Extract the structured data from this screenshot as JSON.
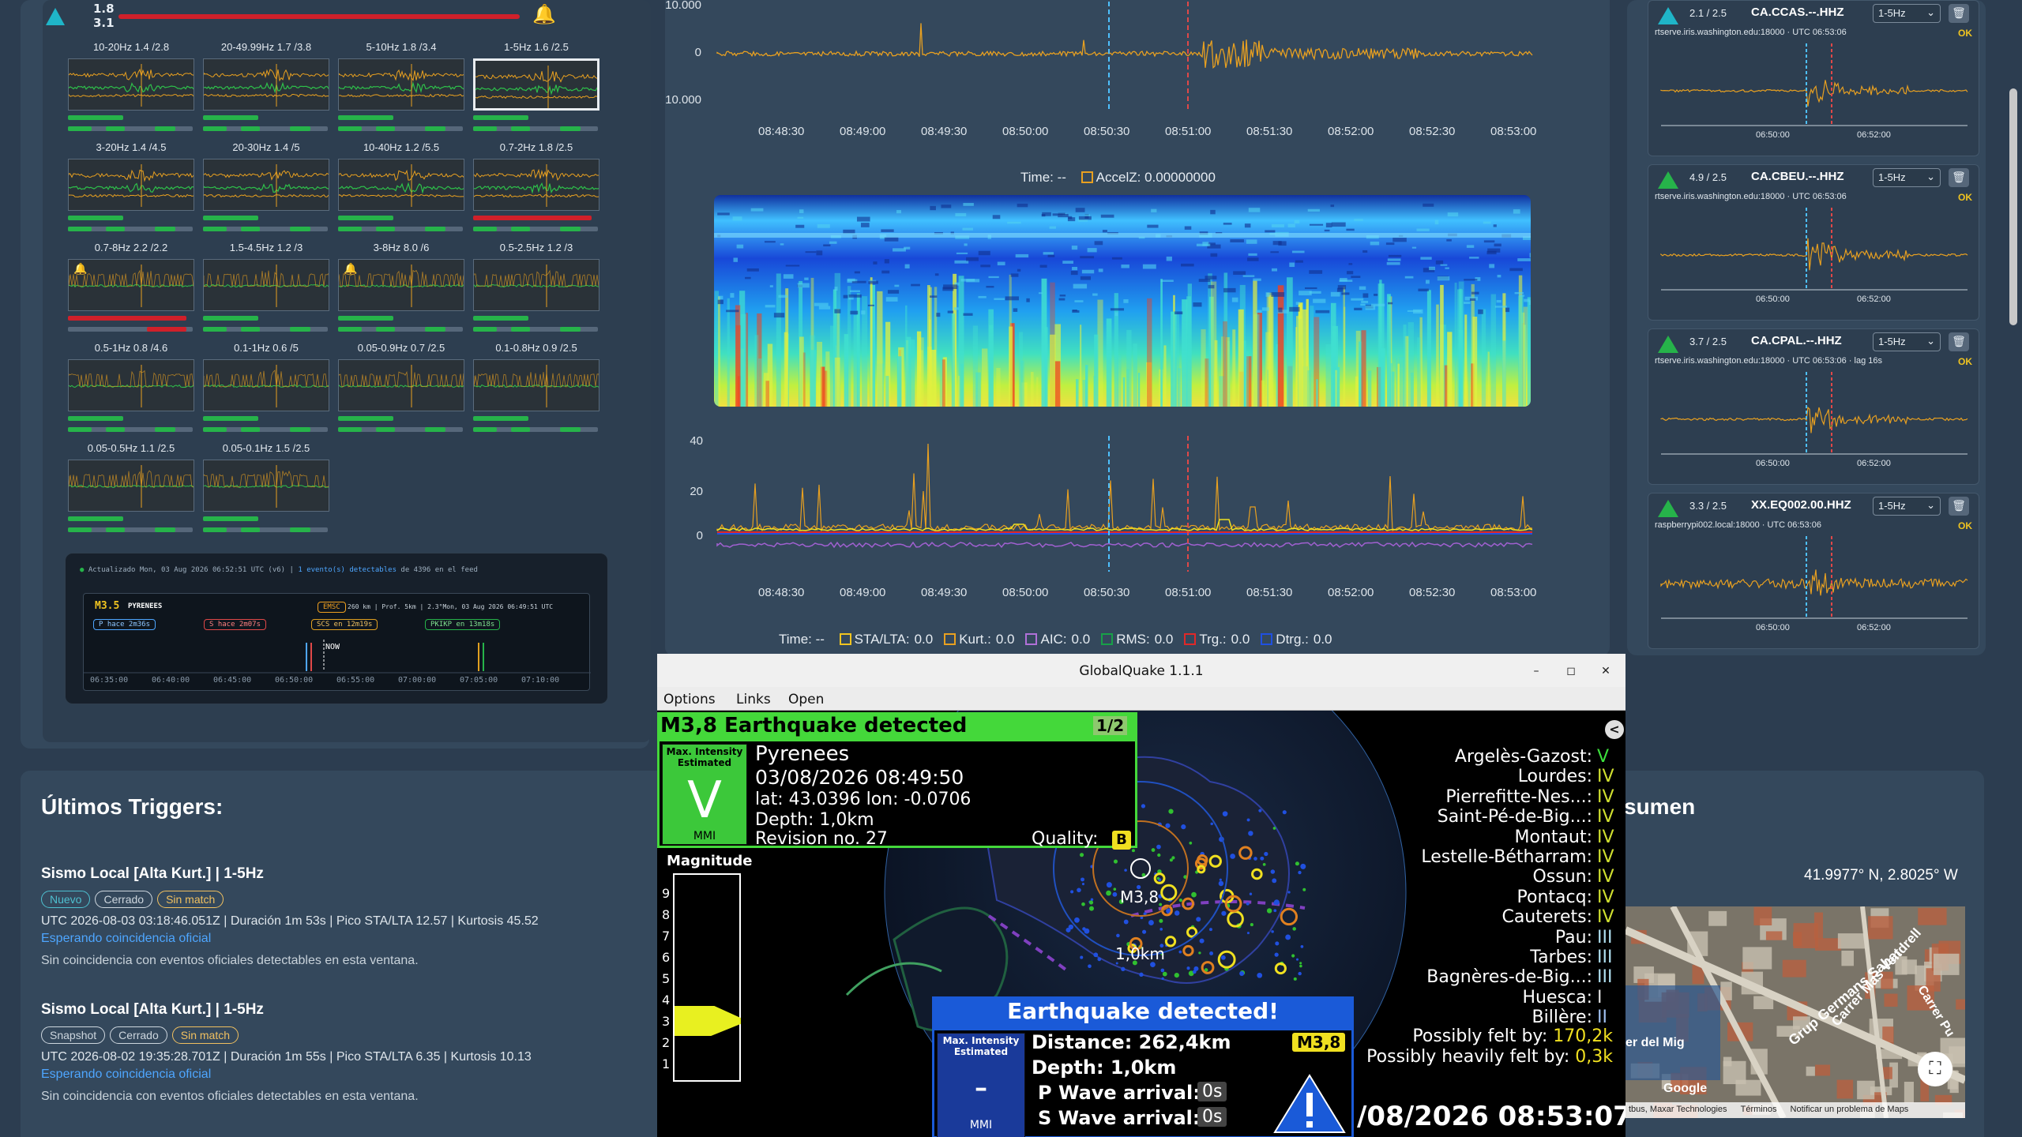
{
  "left_panel": {
    "ratio_top": "1.8",
    "ratio_bottom": "3.1",
    "filters": [
      {
        "label": "10-20Hz 1.4 /2.8",
        "bars": "gg"
      },
      {
        "label": "20-49.99Hz 1.7 /3.8",
        "bars": "gg"
      },
      {
        "label": "5-10Hz 1.8 /3.4",
        "bars": "gg"
      },
      {
        "label": "1-5Hz 1.6 /2.5",
        "bars": "gg",
        "selected": true
      },
      {
        "label": "3-20Hz 1.4 /4.5",
        "bars": "gg"
      },
      {
        "label": "20-30Hz 1.4 /5",
        "bars": "gg"
      },
      {
        "label": "10-40Hz 1.2 /5.5",
        "bars": "gg"
      },
      {
        "label": "0.7-2Hz 1.8 /2.5",
        "bars": "rg"
      },
      {
        "label": "0.7-8Hz 2.2 /2.2",
        "bars": "rr",
        "bell": true
      },
      {
        "label": "1.5-4.5Hz 1.2 /3",
        "bars": "gg"
      },
      {
        "label": "3-8Hz 8.0 /6",
        "bars": "gg",
        "bell": true
      },
      {
        "label": "0.5-2.5Hz 1.2 /3",
        "bars": "gg"
      },
      {
        "label": "0.5-1Hz 0.8 /4.6",
        "bars": "gg"
      },
      {
        "label": "0.1-1Hz 0.6 /5",
        "bars": "gg"
      },
      {
        "label": "0.05-0.9Hz 0.7 /2.5",
        "bars": "gg"
      },
      {
        "label": "0.1-0.8Hz 0.9 /2.5",
        "bars": "gg"
      },
      {
        "label": "0.05-0.5Hz 1.1 /2.5",
        "bars": "gg"
      },
      {
        "label": "0.05-0.1Hz 1.5 /2.5",
        "bars": "gg"
      }
    ],
    "timeline": {
      "updated": "Actualizado Mon, 03 Aug 2026 06:52:51 UTC (v6)",
      "events_link": "1 evento(s) detectables",
      "events_tail": "de 4396 en el feed",
      "mag": "M3.5",
      "region": "PYRENEES",
      "badge": "EMSC",
      "dist": "260 km",
      "depth": "Prof. 5km",
      "extra": "2.3°Mon, 03 Aug 2026 06:49:51 UTC",
      "p_tag": "P hace 2m36s",
      "s_tag": "S hace 2m07s",
      "scs_tag": "SCS en 12m19s",
      "pkikp_tag": "PKIKP en 13m18s",
      "now": "NOW",
      "ticks": [
        "06:35:00",
        "06:40:00",
        "06:45:00",
        "06:50:00",
        "06:55:00",
        "07:00:00",
        "07:05:00",
        "07:10:00"
      ]
    }
  },
  "center": {
    "wave_y": [
      "10.000",
      "0",
      "10.000"
    ],
    "times": [
      "08:48:30",
      "08:49:00",
      "08:49:30",
      "08:50:00",
      "08:50:30",
      "08:51:00",
      "08:51:30",
      "08:52:00",
      "08:52:30",
      "08:53:00"
    ],
    "time_label": "Time:",
    "time_val": "--",
    "accel_label": "AccelZ:",
    "accel_val": "0.00000000",
    "sta_y": [
      "40",
      "20",
      "0"
    ],
    "legend": [
      {
        "name": "STA/LTA:",
        "val": "0.0",
        "color": "#f0c420"
      },
      {
        "name": "Kurt.:",
        "val": "0.0",
        "color": "#e8a020"
      },
      {
        "name": "AIC:",
        "val": "0.0",
        "color": "#b070d8"
      },
      {
        "name": "RMS:",
        "val": "0.0",
        "color": "#18a048"
      },
      {
        "name": "Trg.:",
        "val": "0.0",
        "color": "#e02828"
      },
      {
        "name": "Dtrg.:",
        "val": "0.0",
        "color": "#2050e0"
      }
    ]
  },
  "stations": [
    {
      "ratio": "2.1 / 2.5",
      "name": "CA.CCAS.--.HHZ",
      "filter": "1-5Hz",
      "src": "rtserve.iris.washington.edu:18000 · UTC 06:53:06",
      "ok": "OK",
      "tri": "#1fb5c8",
      "ticks": [
        "06:50:00",
        "06:52:00"
      ]
    },
    {
      "ratio": "4.9 / 2.5",
      "name": "CA.CBEU.--.HHZ",
      "filter": "1-5Hz",
      "src": "rtserve.iris.washington.edu:18000 · UTC 06:53:06",
      "ok": "OK",
      "tri": "#26b34a",
      "ticks": [
        "06:50:00",
        "06:52:00"
      ]
    },
    {
      "ratio": "3.7 / 2.5",
      "name": "CA.CPAL.--.HHZ",
      "filter": "1-5Hz",
      "src": "rtserve.iris.washington.edu:18000 · UTC 06:53:06 · lag 16s",
      "ok": "OK",
      "tri": "#26b34a",
      "ticks": [
        "06:50:00",
        "06:52:00"
      ]
    },
    {
      "ratio": "3.3 / 2.5",
      "name": "XX.EQ002.00.HHZ",
      "filter": "1-5Hz",
      "src": "raspberrypi002.local:18000 · UTC 06:53:06",
      "ok": "OK",
      "tri": "#26b34a",
      "ticks": [
        "06:50:00",
        "06:52:00"
      ]
    }
  ],
  "triggers": {
    "title": "Últimos Triggers:",
    "items": [
      {
        "title": "Sismo Local [Alta Kurt.] | 1-5Hz",
        "pills": [
          "Nuevo",
          "Cerrado",
          "Sin match"
        ],
        "detail": "UTC 2026-08-03 03:18:46.051Z | Duración 1m 53s | Pico STA/LTA 12.57 | Kurtosis 45.52",
        "link": "Esperando coincidencia oficial",
        "note": "Sin coincidencia con eventos oficiales detectables en esta ventana."
      },
      {
        "title": "Sismo Local [Alta Kurt.] | 1-5Hz",
        "pills": [
          "Snapshot",
          "Cerrado",
          "Sin match"
        ],
        "detail": "UTC 2026-08-02 19:35:28.701Z | Duración 1m 55s | Pico STA/LTA 6.35 | Kurtosis 10.13",
        "link": "Esperando coincidencia oficial",
        "note": "Sin coincidencia con eventos oficiales detectables en esta ventana."
      }
    ]
  },
  "resumen": {
    "title_tail": "sumen",
    "coords": "41.9977° N, 2.8025° W",
    "map_streets": [
      "Grup Germans Sabat",
      "Carrer Mas Vendrell",
      "Carrer Pu",
      "er del Mig"
    ],
    "attrib": "tbus, Maxar Technologies",
    "terms": "Términos",
    "report": "Notificar un problema de Maps",
    "google": "Google"
  },
  "gq": {
    "title": "GlobalQuake 1.1.1",
    "menu": [
      "Options",
      "Links",
      "Open"
    ],
    "headline": "M3,8 Earthquake detected",
    "page": "1/2",
    "mmi_label": "Max. Intensity Estimated",
    "mmi": "V",
    "mmi_unit": "MMI",
    "region": "Pyrenees",
    "datetime": "03/08/2026 08:49:50",
    "latlon": "lat: 43.0396 lon: -0.0706",
    "depth": "Depth: 1,0km",
    "revision": "Revision no. 27",
    "quality_label": "Quality:",
    "quality": "B",
    "magnitude_label": "Magnitude",
    "mag_scale": [
      "9",
      "8",
      "7",
      "6",
      "5",
      "4",
      "3",
      "2",
      "1"
    ],
    "map_mag": "M3,8",
    "map_depth": "1,0km",
    "cities": [
      {
        "name": "Argelès-Gazost:",
        "mmi": "V",
        "c": "#3ce03c"
      },
      {
        "name": "Lourdes:",
        "mmi": "IV",
        "c": "#d0e030"
      },
      {
        "name": "Pierrefitte-Nes...:",
        "mmi": "IV",
        "c": "#d0e030"
      },
      {
        "name": "Saint-Pé-de-Big...:",
        "mmi": "IV",
        "c": "#d0e030"
      },
      {
        "name": "Montaut:",
        "mmi": "IV",
        "c": "#d0e030"
      },
      {
        "name": "Lestelle-Bétharram:",
        "mmi": "IV",
        "c": "#d0e030"
      },
      {
        "name": "Ossun:",
        "mmi": "IV",
        "c": "#d0e030"
      },
      {
        "name": "Pontacq:",
        "mmi": "IV",
        "c": "#d0e030"
      },
      {
        "name": "Cauterets:",
        "mmi": "IV",
        "c": "#d0e030"
      },
      {
        "name": "Pau:",
        "mmi": "III",
        "c": "#b0e0f0"
      },
      {
        "name": "Tarbes:",
        "mmi": "III",
        "c": "#b0e0f0"
      },
      {
        "name": "Bagnères-de-Big...:",
        "mmi": "III",
        "c": "#b0e0f0"
      },
      {
        "name": "Huesca:",
        "mmi": "I",
        "c": "#e0e0e0"
      },
      {
        "name": "Billère:",
        "mmi": "II",
        "c": "#a0c0f0"
      }
    ],
    "felt_label": "Possibly felt by:",
    "felt": "170,2k",
    "heavy_label": "Possibly heavily felt by:",
    "heavy": "0,3k",
    "detected": "Earthquake detected!",
    "d_mmi_label": "Max. Intensity Estimated",
    "d_mmi": "-",
    "d_mmi_unit": "MMI",
    "distance": "Distance: 262,4km",
    "d_depth": "Depth: 1,0km",
    "d_mag": "M3,8",
    "p_label": "P Wave arrival:",
    "p_val": "0s",
    "s_label": "S Wave arrival:",
    "s_val": "0s",
    "clock": "/08/2026 08:53:07"
  },
  "colors": {
    "accent": "#26b34a",
    "alert": "#d0202a",
    "gq_green": "#3ce03c",
    "gq_blue": "#1a5ad8"
  }
}
